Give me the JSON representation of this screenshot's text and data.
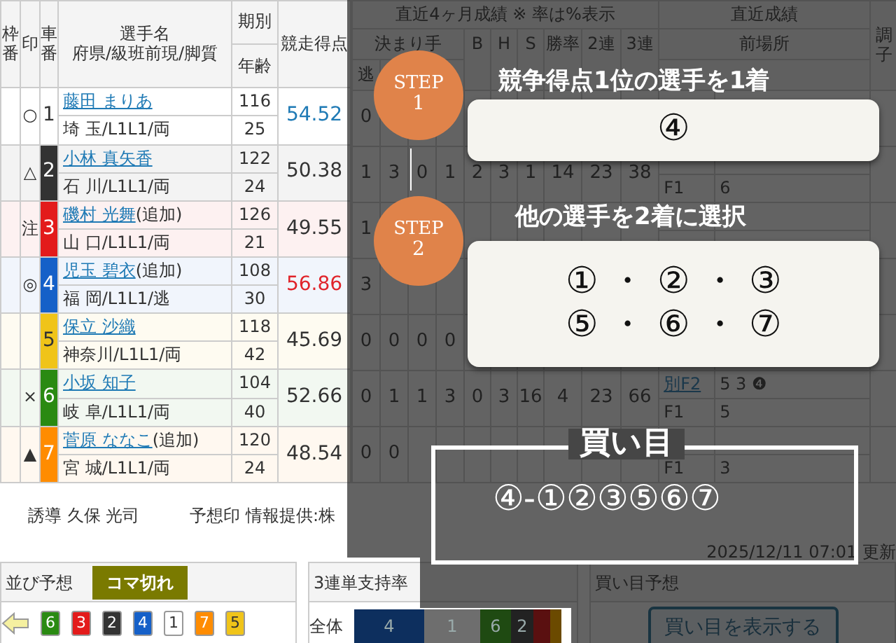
{
  "left_header": {
    "frame": "枠番",
    "mark": "印",
    "car": "車番",
    "name": "選手名",
    "name_sub": "府県/級班前現/脚質",
    "term": "期別",
    "age": "年齢",
    "score": "競走得点"
  },
  "right_header": {
    "recent4": "直近4ヶ月成績 ※ 率は%表示",
    "recent": "直近成績",
    "condition": "調子",
    "kimarite": "決まり手",
    "b": "B",
    "h": "H",
    "s": "S",
    "win": "勝率",
    "ren2": "2連",
    "ren3": "3連",
    "prev": "前場所",
    "nige": "逃"
  },
  "racers": [
    {
      "mark": "○",
      "car": "1",
      "color": "#ffffff",
      "name": "藤田 まりあ",
      "pref": "埼 玉/L1L1/両",
      "term": "116",
      "age": "25",
      "score": {
        "text": "54.52",
        "color": "#1f7ab5"
      },
      "stats": {
        "nige": "0"
      }
    },
    {
      "mark": "△",
      "car": "2",
      "color": "#333333",
      "name": "小林 真矢香",
      "pref": "石 川/L1L1/両",
      "term": "122",
      "age": "24",
      "score": {
        "text": "50.38",
        "color": "#333333"
      },
      "stats": {
        "nige": "1",
        "makuri": "3",
        "sashi": "0",
        "mark": "1",
        "b": "2",
        "h": "3",
        "s": "1",
        "win": "14",
        "ren2": "23",
        "ren3": "38"
      },
      "recent_bottom": {
        "class": "F1",
        "result": "6"
      }
    },
    {
      "mark": "注",
      "car": "3",
      "color": "#e31b1b",
      "name": "磯村 光舞",
      "note": "(追加)",
      "pref": "山 口/L1L1/両",
      "term": "126",
      "age": "21",
      "score": {
        "text": "49.55",
        "color": "#333333"
      },
      "stats": {
        "nige": "1"
      }
    },
    {
      "mark": "◎",
      "car": "4",
      "color": "#1560c8",
      "name": "児玉 碧衣",
      "note": "(追加)",
      "pref": "福 岡/L1L1/逃",
      "term": "108",
      "age": "30",
      "score": {
        "text": "56.86",
        "color": "#e0232a"
      },
      "stats": {
        "nige": "3"
      }
    },
    {
      "car": "5",
      "color": "#f0c419",
      "name": "保立 沙織",
      "pref": "神奈川/L1L1/両",
      "term": "118",
      "age": "42",
      "score": {
        "text": "45.69",
        "color": "#333333"
      },
      "stats": {
        "nige": "0",
        "makuri": "0",
        "sashi": "0",
        "mark": "0"
      }
    },
    {
      "mark": "×",
      "car": "6",
      "color": "#2a8a12",
      "name": "小坂 知子",
      "pref": "岐 阜/L1L1/両",
      "term": "104",
      "age": "40",
      "score": {
        "text": "52.66",
        "color": "#333333"
      },
      "stats": {
        "nige": "0",
        "makuri": "1",
        "sashi": "1",
        "mark": "3",
        "b": "0",
        "h": "3",
        "s": "16",
        "win": "4",
        "ren2": "23",
        "ren3": "66"
      },
      "recent_top": {
        "class": "別F2",
        "result": "5 3 ❹"
      },
      "recent_bottom": {
        "class": "F1",
        "result": "5"
      }
    },
    {
      "mark": "▲",
      "car": "7",
      "color": "#ff8c00",
      "name": "菅原 ななこ",
      "note": "(追加)",
      "pref": "宮 城/L1L1/両",
      "term": "120",
      "age": "24",
      "score": {
        "text": "48.54",
        "color": "#333333"
      },
      "stats": {
        "nige": "0",
        "makuri": "0"
      },
      "recent_bottom": {
        "class": "F1",
        "result": "3"
      }
    }
  ],
  "footer": {
    "leader": "誘導 久保 光司",
    "credit": "予想印 情報提供:株",
    "updated": "2025/12/11 07:01 更新"
  },
  "line_panel": {
    "title": "並び予想",
    "badge": "コマ切れ",
    "cars": [
      {
        "num": "6",
        "color": "#2a8a12"
      },
      {
        "num": "3",
        "color": "#e31b1b"
      },
      {
        "num": "2",
        "color": "#333333"
      },
      {
        "num": "4",
        "color": "#1560c8"
      },
      {
        "num": "1",
        "color": "#ffffff"
      },
      {
        "num": "7",
        "color": "#ff8c00"
      },
      {
        "num": "5",
        "color": "#f0c419"
      }
    ]
  },
  "support_panel": {
    "title": "3連単支持率",
    "label": "全体",
    "segments": [
      {
        "label": "4",
        "color": "#0d2f5e"
      },
      {
        "label": "1",
        "color": "#6e6e6e"
      },
      {
        "label": "6",
        "color": "#1f4a12"
      },
      {
        "label": "2",
        "color": "#222222"
      },
      {
        "color": "#5a1010"
      },
      {
        "color": "#6b4a00"
      }
    ]
  },
  "bet_panel": {
    "title": "買い目予想",
    "button": "買い目を表示する"
  },
  "guide": {
    "step1": {
      "badge": "STEP",
      "num": "1",
      "title": "競争得点1位の選手を1着",
      "rows": [
        "④"
      ]
    },
    "step2": {
      "badge": "STEP",
      "num": "2",
      "title": "他の選手を2着に選択",
      "rows": [
        "① ・ ② ・ ③",
        "⑤ ・ ⑥ ・ ⑦"
      ]
    },
    "bet": {
      "label": "買い目",
      "text": "④-①②③⑤⑥⑦"
    }
  }
}
